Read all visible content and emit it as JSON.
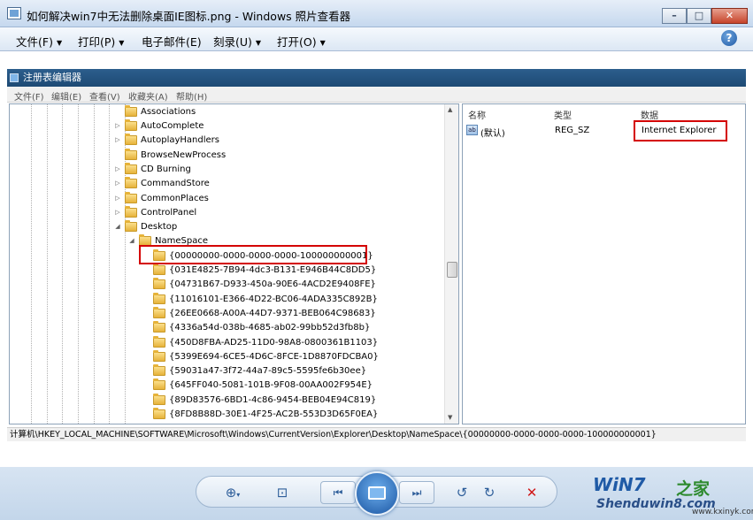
{
  "window": {
    "title": "如何解决win7中无法删除桌面IE图标.png - Windows 照片查看器"
  },
  "menu": {
    "file": "文件(F)",
    "print": "打印(P)",
    "email": "电子邮件(E)",
    "burn": "刻录(U)",
    "open": "打开(O)"
  },
  "regedit": {
    "title": "注册表编辑器",
    "menu": [
      "文件(F)",
      "编辑(E)",
      "查看(V)",
      "收藏夹(A)",
      "帮助(H)"
    ],
    "tree": [
      "Associations",
      "AutoComplete",
      "AutoplayHandlers",
      "BrowseNewProcess",
      "CD Burning",
      "CommandStore",
      "CommonPlaces",
      "ControlPanel",
      "Desktop",
      "NameSpace",
      "{00000000-0000-0000-0000-100000000001}",
      "{031E4825-7B94-4dc3-B131-E946B44C8DD5}",
      "{04731B67-D933-450a-90E6-4ACD2E9408FE}",
      "{11016101-E366-4D22-BC06-4ADA335C892B}",
      "{26EE0668-A00A-44D7-9371-BEB064C98683}",
      "{4336a54d-038b-4685-ab02-99bb52d3fb8b}",
      "{450D8FBA-AD25-11D0-98A8-0800361B1103}",
      "{5399E694-6CE5-4D6C-8FCE-1D8870FDCBA0}",
      "{59031a47-3f72-44a7-89c5-5595fe6b30ee}",
      "{645FF040-5081-101B-9F08-00AA002F954E}",
      "{89D83576-6BD1-4c86-9454-BEB04E94C819}",
      "{8FD8B88D-30E1-4F25-AC2B-553D3D65F0EA}"
    ],
    "columns": {
      "name": "名称",
      "type": "类型",
      "data": "数据"
    },
    "value": {
      "name": "(默认)",
      "type": "REG_SZ",
      "data": "Internet Explorer",
      "icon": "ab"
    },
    "status": "计算机\\HKEY_LOCAL_MACHINE\\SOFTWARE\\Microsoft\\Windows\\CurrentVersion\\Explorer\\Desktop\\NameSpace\\{00000000-0000-0000-0000-100000000001}"
  },
  "watermark": {
    "line1": "WiN7",
    "line2": "之家",
    "line3": "Shenduwin8.com",
    "line4": "www.kxinyk.com"
  }
}
